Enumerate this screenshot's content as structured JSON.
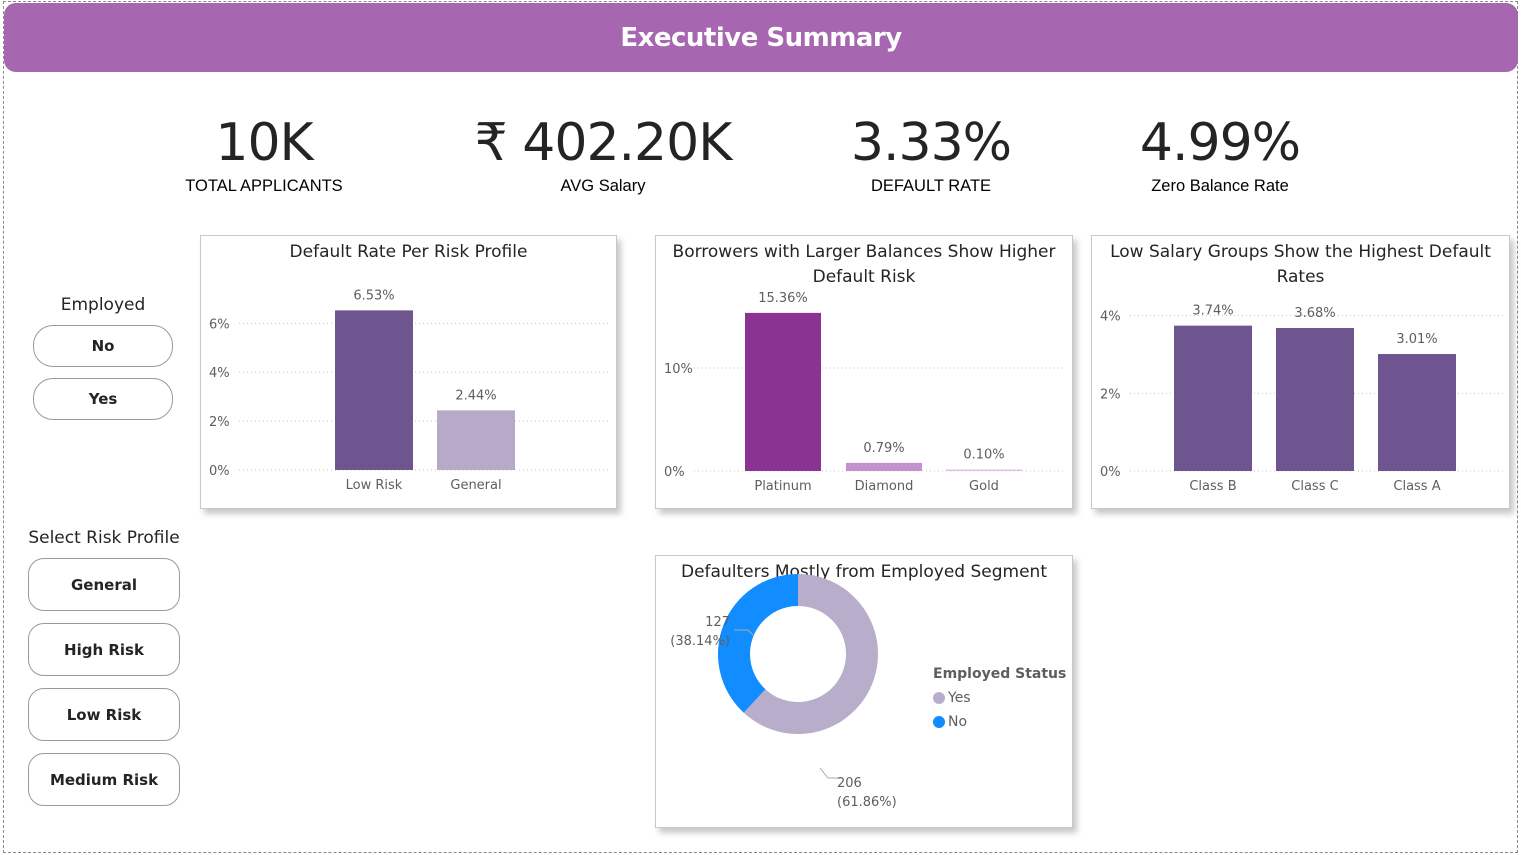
{
  "header": {
    "title": "Executive Summary"
  },
  "kpis": [
    {
      "value": "10K",
      "label": "TOTAL APPLICANTS"
    },
    {
      "value": "₹ 402.20K",
      "label": "AVG Salary"
    },
    {
      "value": "3.33%",
      "label": "DEFAULT RATE"
    },
    {
      "value": "4.99%",
      "label": "Zero Balance Rate"
    }
  ],
  "slicers": {
    "employed": {
      "title": "Employed",
      "options": [
        "No",
        "Yes"
      ]
    },
    "risk": {
      "title": "Select Risk Profile",
      "options": [
        "General",
        "High Risk",
        "Low Risk",
        "Medium Risk"
      ]
    }
  },
  "colors": {
    "accent": "#a667b0",
    "bar_dark": "#6e558f",
    "bar_light": "#b8a9c8",
    "platinum": "#8a3393",
    "diamond": "#c391cc",
    "gold": "#dcc2e0",
    "donut_yes": "#b8aecb",
    "donut_no": "#118dff"
  },
  "chart_data": [
    {
      "type": "bar",
      "title": "Default Rate Per Risk Profile",
      "categories": [
        "Low Risk",
        "General"
      ],
      "values": [
        6.53,
        2.44
      ],
      "data_labels": [
        "6.53%",
        "2.44%"
      ],
      "ticks": [
        "0%",
        "2%",
        "4%",
        "6%"
      ],
      "tick_values": [
        0,
        2,
        4,
        6
      ],
      "ylim": [
        0,
        7.2
      ],
      "grid": true
    },
    {
      "type": "bar",
      "title": "Borrowers with Larger Balances Show Higher Default Risk",
      "categories": [
        "Platinum",
        "Diamond",
        "Gold"
      ],
      "values": [
        15.36,
        0.79,
        0.1
      ],
      "data_labels": [
        "15.36%",
        "0.79%",
        "0.10%"
      ],
      "ticks": [
        "0%",
        "10%"
      ],
      "tick_values": [
        0,
        10
      ],
      "ylim": [
        0,
        17
      ],
      "grid": true
    },
    {
      "type": "bar",
      "title": "Low Salary Groups Show the Highest Default Rates",
      "categories": [
        "Class B",
        "Class C",
        "Class A"
      ],
      "values": [
        3.74,
        3.68,
        3.01
      ],
      "data_labels": [
        "3.74%",
        "3.68%",
        "3.01%"
      ],
      "ticks": [
        "0%",
        "2%",
        "4%"
      ],
      "tick_values": [
        0,
        2,
        4
      ],
      "ylim": [
        0,
        4.4
      ],
      "grid": true
    },
    {
      "type": "pie",
      "title": "Defaulters Mostly from Employed Segment",
      "categories": [
        "Yes",
        "No"
      ],
      "values": [
        206,
        127
      ],
      "percent_labels": [
        "(61.86%)",
        "(38.14%)"
      ],
      "legend_title": "Employed Status",
      "legend_placement": "right"
    }
  ]
}
